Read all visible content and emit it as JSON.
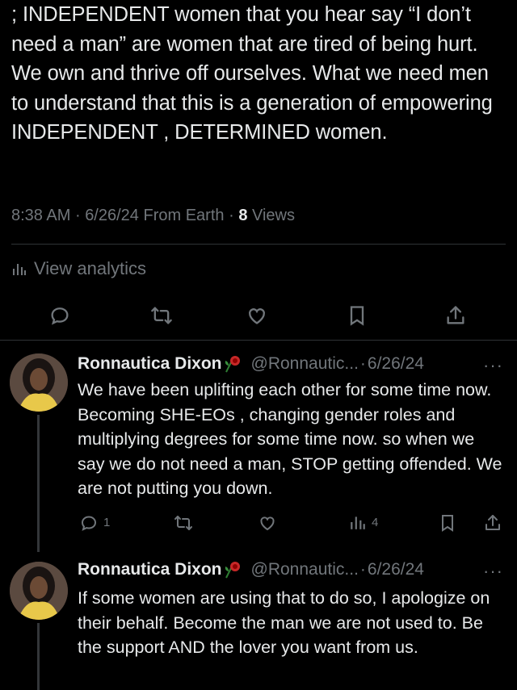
{
  "tweet": {
    "text": "; INDEPENDENT women that you hear say “I don’t need a man” are women that are tired of being hurt. We own and thrive off ourselves. What we need men to understand that this is a generation of empowering INDEPENDENT , DETERMINED women.",
    "time": "8:38 AM",
    "date": "6/26/24",
    "source": "From Earth",
    "views_count": "8",
    "views_label": "Views",
    "analytics_label": "View analytics"
  },
  "replies": [
    {
      "name": "Ronnautica Dixon",
      "handle": "@Ronnautic...",
      "date": "6/26/24",
      "text": "We have been uplifting each other for some time now. Becoming SHE-EOs , changing gender roles and multiplying degrees for some time now. so when we say we do not need a man, STOP getting offended. We are not putting you down.",
      "reply_count": "1",
      "views_count": "4"
    },
    {
      "name": "Ronnautica Dixon",
      "handle": "@Ronnautic...",
      "date": "6/26/24",
      "text": "If some women are using that to do so, I apologize on their behalf. Become the man we are not used to. Be the support AND the lover you want from us."
    }
  ],
  "separators": {
    "dot": "·",
    "more": "···"
  },
  "icons": [
    "reply-icon",
    "retweet-icon",
    "like-icon",
    "bookmark-icon",
    "share-icon",
    "analytics-icon",
    "rose-emoji"
  ],
  "colors": {
    "background": "#000000",
    "text": "#e7e9ea",
    "muted": "#71767b",
    "divider": "#2f3336"
  }
}
